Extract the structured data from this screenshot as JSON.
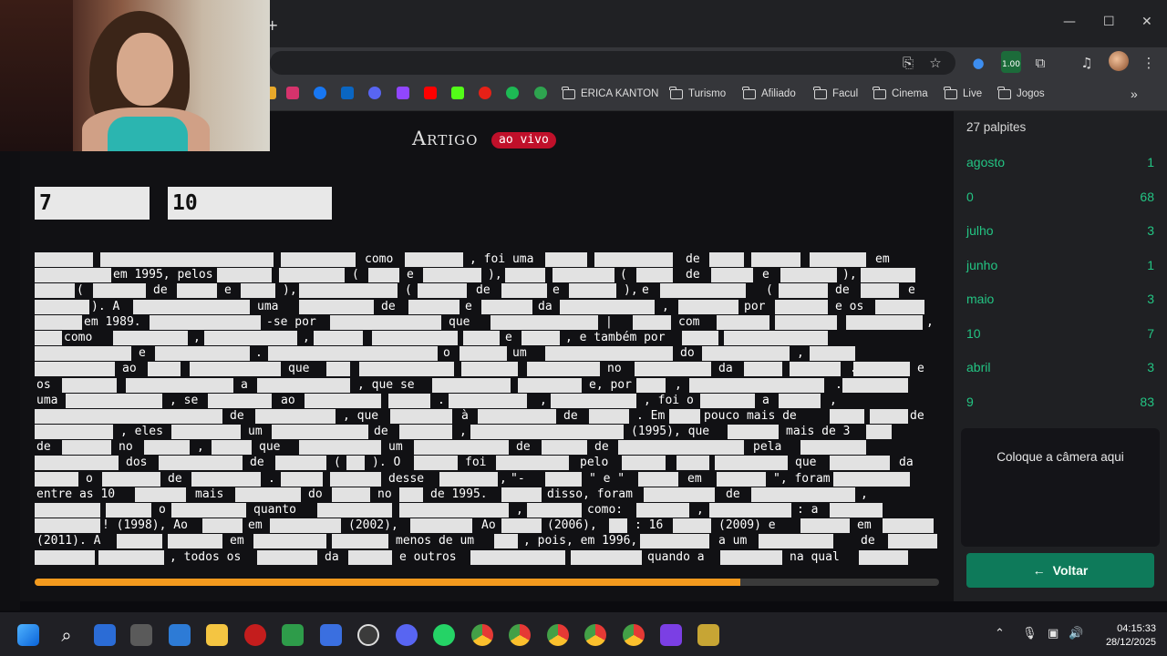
{
  "browser": {
    "bookmarks": [
      "ERICA KANTON",
      "Turismo",
      "Afiliado",
      "Facul",
      "Cinema",
      "Live",
      "Jogos"
    ],
    "extension_badge": "1.00"
  },
  "article": {
    "title": "Artigo",
    "live_label": "ao vivo",
    "title_numbers": [
      "7",
      "10"
    ],
    "progress_fraction": 0.78,
    "lines": [
      [
        [
          0,
          64
        ],
        [
          72,
          190
        ],
        [
          180,
          262
        ],
        [
          270,
          352
        ],
        [
          360,
          "como"
        ],
        [
          406,
          470
        ],
        [
          475,
          ", foi uma"
        ],
        [
          560,
          606
        ],
        [
          614,
          700
        ],
        [
          712,
          "de"
        ],
        [
          740,
          778
        ],
        [
          786,
          840
        ],
        [
          850,
          912
        ],
        [
          920,
          "em"
        ]
      ],
      [
        [
          0,
          84
        ],
        [
          84,
          "em 1995, pelos"
        ],
        [
          200,
          260
        ],
        [
          268,
          340
        ],
        [
          346,
          "("
        ],
        [
          366,
          400
        ],
        [
          406,
          "e"
        ],
        [
          426,
          490
        ],
        [
          495,
          "),"
        ],
        [
          516,
          560
        ],
        [
          568,
          636
        ],
        [
          640,
          "("
        ],
        [
          660,
          700
        ],
        [
          712,
          "de"
        ],
        [
          742,
          788
        ],
        [
          796,
          "e"
        ],
        [
          818,
          880
        ],
        [
          884,
          "),"
        ],
        [
          906,
          966
        ]
      ],
      [
        [
          0,
          44
        ],
        [
          44,
          "("
        ],
        [
          64,
          122
        ],
        [
          128,
          "de"
        ],
        [
          156,
          200
        ],
        [
          206,
          "e"
        ],
        [
          226,
          264
        ],
        [
          270,
          "),"
        ],
        [
          290,
          398
        ],
        [
          404,
          "("
        ],
        [
          420,
          474
        ],
        [
          482,
          "de"
        ],
        [
          512,
          562
        ],
        [
          566,
          "e"
        ],
        [
          586,
          638
        ],
        [
          644,
          "),"
        ],
        [
          664,
          "e"
        ],
        [
          686,
          780
        ],
        [
          800,
          "("
        ],
        [
          816,
          870
        ],
        [
          876,
          "de"
        ],
        [
          906,
          948
        ],
        [
          956,
          "e"
        ]
      ],
      [
        [
          0,
          60
        ],
        [
          60,
          "). A"
        ],
        [
          108,
          236
        ],
        [
          242,
          "uma"
        ],
        [
          290,
          372
        ],
        [
          378,
          "de"
        ],
        [
          410,
          466
        ],
        [
          470,
          "e"
        ],
        [
          490,
          546
        ],
        [
          550,
          "da"
        ],
        [
          576,
          680
        ],
        [
          686,
          ","
        ],
        [
          706,
          772
        ],
        [
          776,
          "por"
        ],
        [
          812,
          870
        ],
        [
          876,
          "e os"
        ],
        [
          922,
          976
        ]
      ],
      [
        [
          0,
          52
        ],
        [
          52,
          "em 1989."
        ],
        [
          126,
          248
        ],
        [
          252,
          "-se por"
        ],
        [
          324,
          446
        ],
        [
          452,
          "que"
        ],
        [
          500,
          618
        ],
        [
          624,
          "|"
        ],
        [
          656,
          698
        ],
        [
          704,
          "com"
        ],
        [
          748,
          806
        ],
        [
          812,
          880
        ],
        [
          890,
          974
        ],
        [
          976,
          ","
        ]
      ],
      [
        [
          0,
          30
        ],
        [
          30,
          "como"
        ],
        [
          86,
          168
        ],
        [
          172,
          ","
        ],
        [
          186,
          288
        ],
        [
          292,
          ","
        ],
        [
          306,
          360
        ],
        [
          370,
          464
        ],
        [
          470,
          510
        ],
        [
          514,
          "e"
        ],
        [
          534,
          576
        ],
        [
          580,
          ", e também por"
        ],
        [
          710,
          750
        ],
        [
          756,
          870
        ]
      ],
      [
        [
          0,
          106
        ],
        [
          112,
          "e"
        ],
        [
          132,
          236
        ],
        [
          240,
          "."
        ],
        [
          256,
          442
        ],
        [
          446,
          "o"
        ],
        [
          466,
          518
        ],
        [
          522,
          "um"
        ],
        [
          560,
          700
        ],
        [
          706,
          "do"
        ],
        [
          732,
          828
        ],
        [
          834,
          ","
        ],
        [
          850,
          900
        ]
      ],
      [
        [
          0,
          88
        ],
        [
          94,
          "ao"
        ],
        [
          124,
          160
        ],
        [
          170,
          270
        ],
        [
          276,
          "que"
        ],
        [
          320,
          346
        ],
        [
          356,
          460
        ],
        [
          468,
          530
        ],
        [
          540,
          620
        ],
        [
          626,
          "no"
        ],
        [
          658,
          742
        ],
        [
          748,
          "da"
        ],
        [
          778,
          820
        ],
        [
          828,
          884
        ],
        [
          892,
          "."
        ],
        [
          898,
          960
        ],
        [
          966,
          "e"
        ]
      ],
      [
        [
          0,
          "os"
        ],
        [
          30,
          90
        ],
        [
          100,
          218
        ],
        [
          224,
          "a"
        ],
        [
          244,
          346
        ],
        [
          352,
          ", que se"
        ],
        [
          436,
          522
        ],
        [
          530,
          600
        ],
        [
          606,
          "e, por"
        ],
        [
          660,
          692
        ],
        [
          700,
          ","
        ],
        [
          718,
          866
        ],
        [
          876,
          "."
        ],
        [
          886,
          958
        ]
      ],
      [
        [
          0,
          "uma"
        ],
        [
          34,
          140
        ],
        [
          146,
          ", se"
        ],
        [
          190,
          260
        ],
        [
          268,
          "ao"
        ],
        [
          296,
          380
        ],
        [
          388,
          434
        ],
        [
          440,
          "."
        ],
        [
          454,
          540
        ],
        [
          552,
          ","
        ],
        [
          566,
          660
        ],
        [
          666,
          ", foi o"
        ],
        [
          730,
          790
        ],
        [
          796,
          "a"
        ],
        [
          816,
          862
        ],
        [
          870,
          ","
        ]
      ],
      [
        [
          0,
          206
        ],
        [
          212,
          "de"
        ],
        [
          242,
          330
        ],
        [
          336,
          ", que"
        ],
        [
          390,
          458
        ],
        [
          466,
          "à"
        ],
        [
          486,
          572
        ],
        [
          578,
          "de"
        ],
        [
          608,
          652
        ],
        [
          658,
          ". Em"
        ],
        [
          696,
          730
        ],
        [
          732,
          "pouco mais de"
        ],
        [
          872,
          910
        ],
        [
          916,
          966
        ],
        [
          958,
          "de"
        ]
      ],
      [
        [
          0,
          86
        ],
        [
          92,
          ", eles"
        ],
        [
          150,
          226
        ],
        [
          232,
          "um"
        ],
        [
          260,
          366
        ],
        [
          370,
          "de"
        ],
        [
          400,
          458
        ],
        [
          464,
          ","
        ],
        [
          478,
          646
        ],
        [
          652,
          "(1995), que"
        ],
        [
          760,
          816
        ],
        [
          822,
          "mais de 3"
        ],
        [
          912,
          940
        ]
      ],
      [
        [
          0,
          "de"
        ],
        [
          30,
          84
        ],
        [
          90,
          "no"
        ],
        [
          120,
          170
        ],
        [
          176,
          ","
        ],
        [
          194,
          238
        ],
        [
          244,
          "que"
        ],
        [
          290,
          380
        ],
        [
          386,
          "um"
        ],
        [
          416,
          520
        ],
        [
          526,
          "de"
        ],
        [
          556,
          606
        ],
        [
          612,
          "de"
        ],
        [
          640,
          778
        ],
        [
          786,
          "pela"
        ],
        [
          840,
          912
        ]
      ],
      [
        [
          0,
          92
        ],
        [
          98,
          "dos"
        ],
        [
          136,
          228
        ],
        [
          234,
          "de"
        ],
        [
          264,
          320
        ],
        [
          326,
          "("
        ],
        [
          342,
          362
        ],
        [
          368,
          "). O"
        ],
        [
          416,
          464
        ],
        [
          470,
          "foi"
        ],
        [
          506,
          586
        ],
        [
          596,
          "pelo"
        ],
        [
          644,
          692
        ],
        [
          704,
          740
        ],
        [
          746,
          826
        ],
        [
          832,
          "que"
        ],
        [
          872,
          938
        ],
        [
          946,
          "da"
        ]
      ],
      [
        [
          0,
          48
        ],
        [
          54,
          "o"
        ],
        [
          74,
          138
        ],
        [
          144,
          "de"
        ],
        [
          172,
          248
        ],
        [
          254,
          "."
        ],
        [
          270,
          316
        ],
        [
          324,
          380
        ],
        [
          386,
          "desse"
        ],
        [
          444,
          512
        ],
        [
          508,
          ", \""
        ],
        [
          520,
          "\"-"
        ],
        [
          560,
          600
        ],
        [
          606,
          "\" e \""
        ],
        [
          662,
          706
        ],
        [
          714,
          "em"
        ],
        [
          748,
          802
        ],
        [
          808,
          "\", foram"
        ],
        [
          876,
          960
        ]
      ],
      [
        [
          0,
          "entre as 10"
        ],
        [
          110,
          166
        ],
        [
          174,
          "mais"
        ],
        [
          220,
          292
        ],
        [
          298,
          "do"
        ],
        [
          326,
          368
        ],
        [
          374,
          "no"
        ],
        [
          400,
          426
        ],
        [
          432,
          "de 1995."
        ],
        [
          512,
          556
        ],
        [
          560,
          "disso, foram"
        ],
        [
          668,
          746
        ],
        [
          756,
          "de"
        ],
        [
          786,
          900
        ],
        [
          904,
          ","
        ]
      ],
      [
        [
          0,
          72
        ],
        [
          78,
          128
        ],
        [
          134,
          "o"
        ],
        [
          150,
          232
        ],
        [
          238,
          "quanto"
        ],
        [
          310,
          392
        ],
        [
          400,
          520
        ],
        [
          526,
          ","
        ],
        [
          540,
          600
        ],
        [
          604,
          "como:"
        ],
        [
          660,
          718
        ],
        [
          724,
          ","
        ],
        [
          740,
          830
        ],
        [
          834,
          ": a"
        ],
        [
          872,
          930
        ]
      ],
      [
        [
          0,
          72
        ],
        [
          72,
          "! (1998), Ao"
        ],
        [
          184,
          228
        ],
        [
          232,
          "em"
        ],
        [
          258,
          336
        ],
        [
          342,
          "(2002),"
        ],
        [
          412,
          480
        ],
        [
          488,
          "Ao"
        ],
        [
          512,
          556
        ],
        [
          560,
          "(2006),"
        ],
        [
          630,
          650
        ],
        [
          656,
          ": 16"
        ],
        [
          700,
          742
        ],
        [
          748,
          "(2009) e"
        ],
        [
          840,
          894
        ],
        [
          900,
          "em"
        ],
        [
          930,
          986
        ]
      ],
      [
        [
          0,
          "(2011). A"
        ],
        [
          90,
          140
        ],
        [
          146,
          206
        ],
        [
          212,
          "em"
        ],
        [
          240,
          320
        ],
        [
          326,
          388
        ],
        [
          394,
          "menos de um"
        ],
        [
          504,
          530
        ],
        [
          534,
          ", pois, em 1996,"
        ],
        [
          664,
          740
        ],
        [
          748,
          "a um"
        ],
        [
          794,
          876
        ],
        [
          904,
          "de"
        ],
        [
          936,
          990
        ]
      ],
      [
        [
          0,
          66
        ],
        [
          70,
          142
        ],
        [
          146,
          ", todos os"
        ],
        [
          244,
          310
        ],
        [
          316,
          "da"
        ],
        [
          344,
          392
        ],
        [
          398,
          "e outros"
        ],
        [
          478,
          582
        ],
        [
          588,
          666
        ],
        [
          670,
          "quando a"
        ],
        [
          752,
          820
        ],
        [
          826,
          "na qual"
        ],
        [
          904,
          958
        ]
      ]
    ]
  },
  "guesses": {
    "title": "27 palpites",
    "items": [
      {
        "word": "agosto",
        "count": "1"
      },
      {
        "word": "0",
        "count": "68"
      },
      {
        "word": "julho",
        "count": "3"
      },
      {
        "word": "junho",
        "count": "1"
      },
      {
        "word": "maio",
        "count": "3"
      },
      {
        "word": "10",
        "count": "7"
      },
      {
        "word": "abril",
        "count": "3"
      },
      {
        "word": "9",
        "count": "83"
      }
    ],
    "camera_placeholder": "Coloque a câmera aqui",
    "back_label": "Voltar"
  },
  "taskbar": {
    "time": "04:15:33",
    "date": "28/12/2025"
  }
}
